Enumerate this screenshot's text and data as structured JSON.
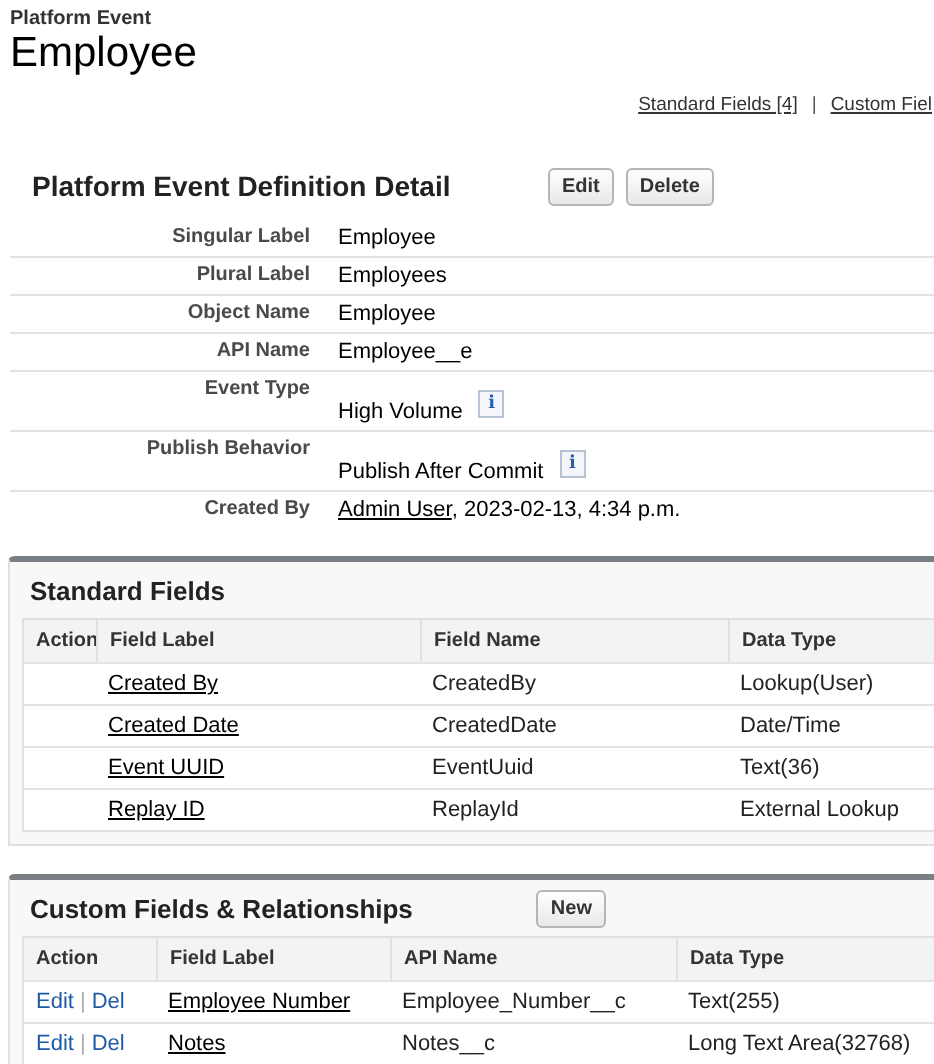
{
  "header": {
    "eyebrow": "Platform Event",
    "title": "Employee"
  },
  "quick_links": {
    "items": [
      "Standard Fields [4]",
      "Custom Fiel"
    ],
    "separator": "|"
  },
  "detail": {
    "title": "Platform Event Definition Detail",
    "buttons": [
      "Edit",
      "Delete"
    ],
    "rows": [
      {
        "label": "Singular Label",
        "value": "Employee",
        "kind": "text"
      },
      {
        "label": "Plural Label",
        "value": "Employees",
        "kind": "text"
      },
      {
        "label": "Object Name",
        "value": "Employee",
        "kind": "text"
      },
      {
        "label": "API Name",
        "value": "Employee__e",
        "kind": "text"
      },
      {
        "label": "Event Type",
        "value": "High Volume",
        "kind": "info",
        "info_icon": "i"
      },
      {
        "label": "Publish Behavior",
        "value": "Publish After Commit",
        "kind": "info",
        "info_icon": "i"
      },
      {
        "label": "Created By",
        "link": "Admin User",
        "value": ", 2023-02-13, 4:34 p.m.",
        "kind": "link"
      }
    ]
  },
  "standard_fields": {
    "title": "Standard Fields",
    "columns": [
      "Action",
      "Field Label",
      "Field Name",
      "Data Type"
    ],
    "rows": [
      {
        "actions": [],
        "field_label": "Created By",
        "name": "CreatedBy",
        "data_type": "Lookup(User)"
      },
      {
        "actions": [],
        "field_label": "Created Date",
        "name": "CreatedDate",
        "data_type": "Date/Time"
      },
      {
        "actions": [],
        "field_label": "Event UUID",
        "name": "EventUuid",
        "data_type": "Text(36)"
      },
      {
        "actions": [],
        "field_label": "Replay ID",
        "name": "ReplayId",
        "data_type": "External Lookup"
      }
    ]
  },
  "custom_fields": {
    "title": "Custom Fields & Relationships",
    "button": "New",
    "action_separator": "|",
    "columns": [
      "Action",
      "Field Label",
      "API Name",
      "Data Type"
    ],
    "rows": [
      {
        "actions": [
          "Edit",
          "Del"
        ],
        "field_label": "Employee Number",
        "name": "Employee_Number__c",
        "data_type": "Text(255)"
      },
      {
        "actions": [
          "Edit",
          "Del"
        ],
        "field_label": "Notes",
        "name": "Notes__c",
        "data_type": "Long Text Area(32768)"
      }
    ]
  }
}
